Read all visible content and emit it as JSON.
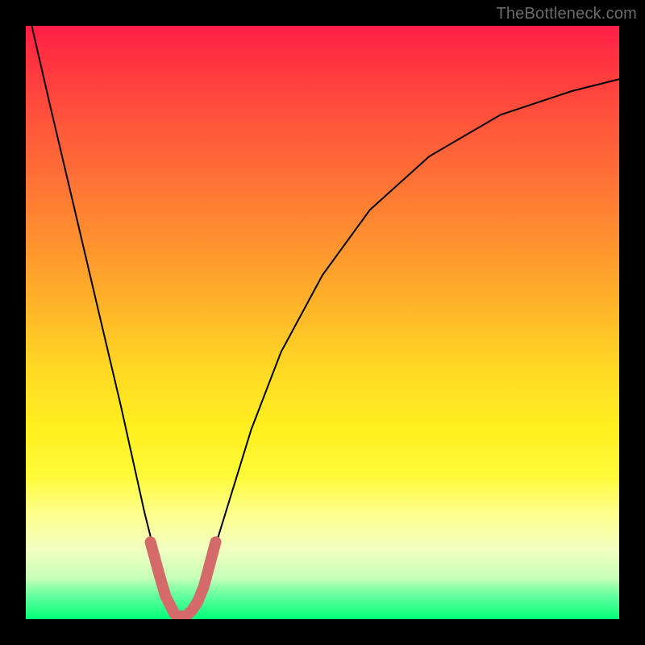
{
  "watermark": "TheBottleneck.com",
  "chart_data": {
    "type": "line",
    "title": "",
    "xlabel": "",
    "ylabel": "",
    "x_range": [
      0,
      1
    ],
    "y_range": [
      0,
      1
    ],
    "series": [
      {
        "name": "bottleneck-curve",
        "color": "#000000",
        "x": [
          0.01,
          0.04,
          0.08,
          0.12,
          0.16,
          0.2,
          0.23,
          0.255,
          0.275,
          0.3,
          0.34,
          0.38,
          0.43,
          0.5,
          0.58,
          0.68,
          0.8,
          0.92,
          1.0
        ],
        "values": [
          1.0,
          0.87,
          0.7,
          0.53,
          0.36,
          0.18,
          0.06,
          0.01,
          0.01,
          0.06,
          0.19,
          0.32,
          0.45,
          0.58,
          0.69,
          0.78,
          0.85,
          0.89,
          0.91
        ]
      },
      {
        "name": "optimal-region-marker",
        "color": "#d46a6a",
        "x": [
          0.21,
          0.225,
          0.235,
          0.25,
          0.255,
          0.26,
          0.27,
          0.28,
          0.29,
          0.3,
          0.32
        ],
        "values": [
          0.13,
          0.075,
          0.04,
          0.01,
          0.005,
          0.005,
          0.005,
          0.015,
          0.03,
          0.055,
          0.13
        ]
      }
    ],
    "background": {
      "type": "vertical-gradient",
      "stops": [
        {
          "pos": 0.0,
          "color": "#ff1e48"
        },
        {
          "pos": 0.18,
          "color": "#ff5a3a"
        },
        {
          "pos": 0.46,
          "color": "#ffb02a"
        },
        {
          "pos": 0.68,
          "color": "#fff020"
        },
        {
          "pos": 0.88,
          "color": "#f4ffc0"
        },
        {
          "pos": 1.0,
          "color": "#00ff7a"
        }
      ]
    }
  }
}
